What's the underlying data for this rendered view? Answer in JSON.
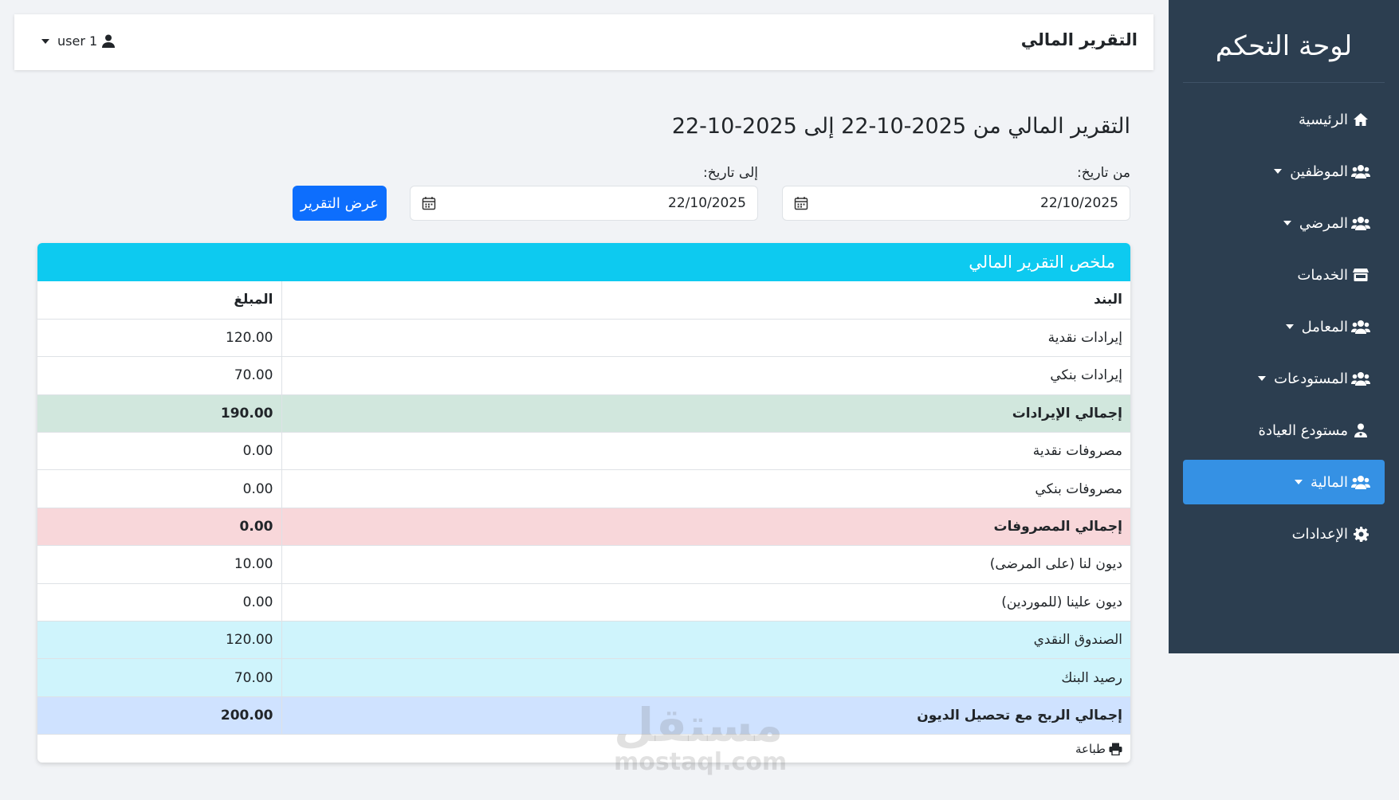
{
  "sidebar": {
    "title": "لوحة التحكم",
    "items": [
      {
        "label": "الرئيسية",
        "icon": "home-icon",
        "caret": false,
        "active": false
      },
      {
        "label": "الموظفين",
        "icon": "users-icon",
        "caret": true,
        "active": false
      },
      {
        "label": "المرضي",
        "icon": "users-icon",
        "caret": true,
        "active": false
      },
      {
        "label": "الخدمات",
        "icon": "store-icon",
        "caret": false,
        "active": false
      },
      {
        "label": "المعامل",
        "icon": "users-icon",
        "caret": true,
        "active": false
      },
      {
        "label": "المستودعات",
        "icon": "users-icon",
        "caret": true,
        "active": false
      },
      {
        "label": "مستودع العيادة",
        "icon": "user-doctor-icon",
        "caret": false,
        "active": false
      },
      {
        "label": "المالية",
        "icon": "users-icon",
        "caret": true,
        "active": true
      },
      {
        "label": "الإعدادات",
        "icon": "gear-icon",
        "caret": false,
        "active": false
      }
    ]
  },
  "header": {
    "title": "التقرير المالي",
    "user": "user 1"
  },
  "filters": {
    "heading": "التقرير المالي من 2025-10-22 إلى 2025-10-22",
    "from_label": "من تاريخ:",
    "from_value": "22/10/2025",
    "to_label": "إلى تاريخ:",
    "to_value": "22/10/2025",
    "button": "عرض التقرير"
  },
  "summary": {
    "title": "ملخص التقرير المالي",
    "col_item": "البند",
    "col_amount": "المبلغ",
    "rows": [
      {
        "item": "إيرادات نقدية",
        "amount": "120.00",
        "style": ""
      },
      {
        "item": "إيرادات بنكي",
        "amount": "70.00",
        "style": ""
      },
      {
        "item": "إجمالي الإيرادات",
        "amount": "190.00",
        "style": "bold green"
      },
      {
        "item": "مصروفات نقدية",
        "amount": "0.00",
        "style": ""
      },
      {
        "item": "مصروفات بنكي",
        "amount": "0.00",
        "style": ""
      },
      {
        "item": "إجمالي المصروفات",
        "amount": "0.00",
        "style": "bold red"
      },
      {
        "item": "ديون لنا (على المرضى)",
        "amount": "10.00",
        "style": ""
      },
      {
        "item": "ديون علينا (للموردين)",
        "amount": "0.00",
        "style": ""
      },
      {
        "item": "الصندوق النقدي",
        "amount": "120.00",
        "style": "cyan"
      },
      {
        "item": "رصيد البنك",
        "amount": "70.00",
        "style": "cyan"
      },
      {
        "item": "إجمالي الربح مع تحصيل الديون",
        "amount": "200.00",
        "style": "bold blue"
      }
    ],
    "print": "طباعة"
  },
  "watermark": {
    "ar": "مستقل",
    "en": "mostaql.com"
  },
  "colors": {
    "sidebar": "#2c3e50",
    "active": "#3591e4",
    "header": "#0dcaf0",
    "button": "#0d6efd"
  }
}
